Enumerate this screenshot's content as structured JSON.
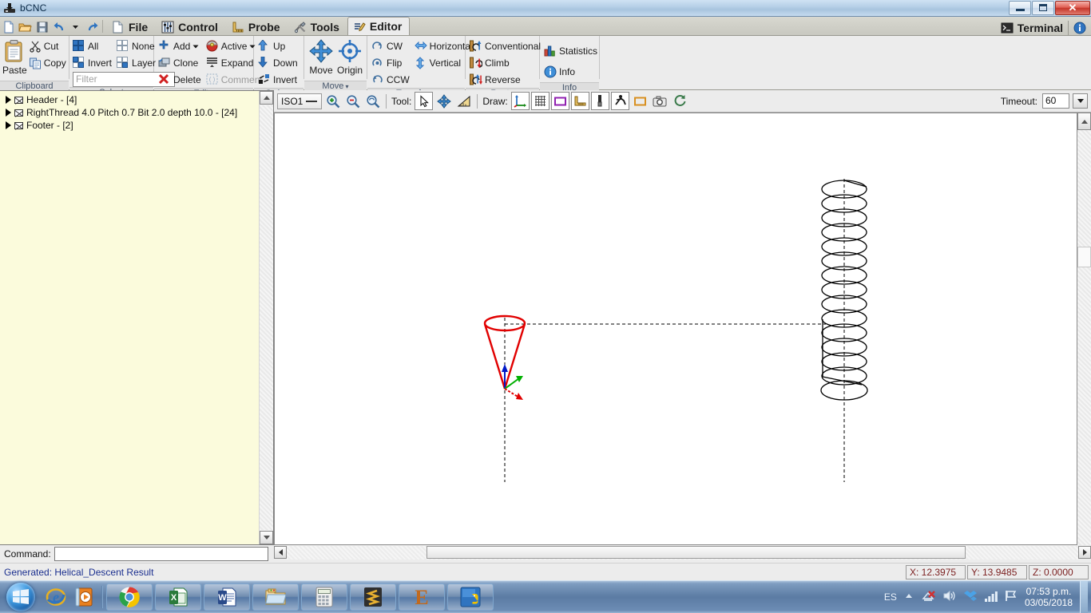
{
  "window": {
    "title": "bCNC",
    "icon": "bcnc-app-icon",
    "minimize_label": "Minimize",
    "maximize_label": "Maximize",
    "close_label": "Close"
  },
  "quick_access": [
    {
      "name": "new-file-icon",
      "label": "New"
    },
    {
      "name": "open-folder-icon",
      "label": "Open"
    },
    {
      "name": "save-icon",
      "label": "Save"
    },
    {
      "name": "undo-icon",
      "label": "Undo"
    },
    {
      "name": "undo-dropdown-icon",
      "label": "Undo history"
    },
    {
      "name": "redo-icon",
      "label": "Redo"
    }
  ],
  "tabs": [
    {
      "label": "File",
      "icon": "page-icon",
      "active": false
    },
    {
      "label": "Control",
      "icon": "sliders-icon",
      "active": false
    },
    {
      "label": "Probe",
      "icon": "ruler-icon",
      "active": false
    },
    {
      "label": "Tools",
      "icon": "tools-icon",
      "active": false
    },
    {
      "label": "Editor",
      "icon": "editor-pen-icon",
      "active": true
    }
  ],
  "tab_right": {
    "terminal_label": "Terminal",
    "terminal_icon": "terminal-icon",
    "info_icon": "info-icon"
  },
  "ribbon": {
    "groups": [
      {
        "name": "clipboard",
        "label": "Clipboard",
        "has_arrow": false,
        "big_buttons": [
          {
            "label": "Paste",
            "icon": "paste-icon"
          }
        ],
        "items": [
          {
            "label": "Cut",
            "icon": "cut-scissors-icon",
            "disabled": false
          },
          {
            "label": "Copy",
            "icon": "copy-icon",
            "disabled": false
          }
        ]
      },
      {
        "name": "select",
        "label": "Select",
        "has_arrow": false,
        "items": [
          {
            "label": "All",
            "icon": "select-all-icon",
            "disabled": false
          },
          {
            "label": "None",
            "icon": "select-none-icon",
            "disabled": false
          },
          {
            "label": "Invert",
            "icon": "select-invert-icon",
            "disabled": false
          },
          {
            "label": "Layer",
            "icon": "select-layer-icon",
            "disabled": false
          }
        ],
        "filter": {
          "placeholder": "Filter",
          "value": ""
        }
      },
      {
        "name": "edit",
        "label": "Edit",
        "has_arrow": true,
        "items": [
          {
            "label": "Add",
            "icon": "add-plus-icon",
            "dropdown": true,
            "disabled": false
          },
          {
            "label": "Active",
            "icon": "active-ball-icon",
            "dropdown": true,
            "disabled": false
          },
          {
            "label": "Clone",
            "icon": "clone-icon",
            "disabled": false
          },
          {
            "label": "Expand",
            "icon": "expand-icon",
            "disabled": false
          },
          {
            "label": "Delete",
            "icon": "delete-x-icon",
            "disabled": false
          },
          {
            "label": "Comment",
            "icon": "comment-icon",
            "disabled": true
          }
        ]
      },
      {
        "name": "order",
        "label": "Order",
        "has_arrow": true,
        "items": [
          {
            "label": "Up",
            "icon": "arrow-up-icon",
            "disabled": false
          },
          {
            "label": "Down",
            "icon": "arrow-down-icon",
            "disabled": false
          },
          {
            "label": "Invert",
            "icon": "order-invert-icon",
            "disabled": false
          }
        ]
      },
      {
        "name": "move",
        "label": "Move",
        "has_arrow": true,
        "big_buttons": [
          {
            "label": "Move",
            "icon": "move-cross-arrows-icon"
          },
          {
            "label": "Origin",
            "icon": "origin-target-icon"
          }
        ],
        "items": []
      },
      {
        "name": "transform",
        "label": "Transform",
        "has_arrow": false,
        "items": [
          {
            "label": "CW",
            "icon": "rotate-cw-icon",
            "disabled": false
          },
          {
            "label": "Horizontal",
            "icon": "flip-horizontal-icon",
            "disabled": false
          },
          {
            "label": "Flip",
            "icon": "flip-icon",
            "disabled": false
          },
          {
            "label": "Vertical",
            "icon": "flip-vertical-icon",
            "disabled": false
          },
          {
            "label": "CCW",
            "icon": "rotate-ccw-icon",
            "disabled": false
          }
        ]
      },
      {
        "name": "route",
        "label": "Route",
        "has_arrow": false,
        "items": [
          {
            "label": "Conventional",
            "icon": "conventional-icon",
            "disabled": false
          },
          {
            "label": "Climb",
            "icon": "climb-icon",
            "disabled": false
          },
          {
            "label": "Reverse",
            "icon": "reverse-icon",
            "disabled": false
          }
        ]
      },
      {
        "name": "info",
        "label": "Info",
        "has_arrow": false,
        "items": [
          {
            "label": "Statistics",
            "icon": "statistics-bars-icon",
            "disabled": false
          },
          {
            "label": "Info",
            "icon": "info-circle-icon",
            "disabled": false
          }
        ]
      }
    ]
  },
  "tree": {
    "rows": [
      {
        "label": "Header - [4]",
        "expander": "collapsed",
        "icon": "block-envelope-icon"
      },
      {
        "label": "RightThread 4.0 Pitch 0.7 Bit 2.0 depth 10.0 - [24]",
        "expander": "collapsed",
        "icon": "block-envelope-icon"
      },
      {
        "label": "Footer - [2]",
        "expander": "collapsed",
        "icon": "block-envelope-icon"
      }
    ]
  },
  "canvas_toolbar": {
    "view_selector": {
      "value": "ISO1",
      "name": "view-mode-selector"
    },
    "zoom_buttons": [
      {
        "name": "zoom-in-icon",
        "label": "Zoom In"
      },
      {
        "name": "zoom-out-icon",
        "label": "Zoom Out"
      },
      {
        "name": "zoom-fit-icon",
        "label": "Zoom Fit"
      }
    ],
    "tool_label": "Tool:",
    "tool_buttons": [
      {
        "name": "select-pointer-icon",
        "label": "Select",
        "active": true
      },
      {
        "name": "pan-move-icon",
        "label": "Pan",
        "active": false
      },
      {
        "name": "gantry-ruler-icon",
        "label": "Ruler",
        "active": false
      }
    ],
    "draw_label": "Draw:",
    "draw_buttons": [
      {
        "name": "axes-icon",
        "label": "Axes",
        "active": true
      },
      {
        "name": "grid-icon",
        "label": "Grid",
        "active": true
      },
      {
        "name": "margin-rect-icon",
        "label": "Margin",
        "active": true
      },
      {
        "name": "probe-ruler-icon",
        "label": "Probe",
        "active": true
      },
      {
        "name": "endmill-icon",
        "label": "Endmill",
        "active": true
      },
      {
        "name": "path-runner-icon",
        "label": "Paths",
        "active": true
      },
      {
        "name": "workarea-icon",
        "label": "Work area",
        "active": false
      },
      {
        "name": "camera-icon",
        "label": "Camera",
        "active": false
      },
      {
        "name": "reset-icon",
        "label": "Reset",
        "active": false
      }
    ],
    "timeout_label": "Timeout:",
    "timeout_value": "60"
  },
  "drawing": {
    "name": "gcode-preview-canvas",
    "description": "Helical descent toolpath preview",
    "accent_tool_color": "#e10000",
    "path_color": "#000000"
  },
  "command_bar": {
    "label": "Command:",
    "value": "",
    "placeholder": ""
  },
  "status": {
    "message": "Generated: Helical_Descent Result",
    "coords": [
      {
        "name": "coord-x",
        "label": "X: 12.3975"
      },
      {
        "name": "coord-y",
        "label": "Y: 13.9485"
      },
      {
        "name": "coord-z",
        "label": "Z: 0.0000"
      }
    ]
  },
  "taskbar": {
    "start_label": "Start",
    "quick_launch": [
      {
        "name": "internet-explorer-icon",
        "label": "Internet Explorer"
      },
      {
        "name": "media-player-icon",
        "label": "Windows Media Player"
      }
    ],
    "task_buttons": [
      {
        "name": "chrome-icon",
        "label": "Google Chrome"
      },
      {
        "name": "excel-icon",
        "label": "Microsoft Excel"
      },
      {
        "name": "word-icon",
        "label": "Microsoft Word"
      },
      {
        "name": "explorer-icon",
        "label": "Windows Explorer"
      },
      {
        "name": "calculator-icon",
        "label": "Calculator"
      },
      {
        "name": "sublime-icon",
        "label": "Sublime Text"
      },
      {
        "name": "editor-e-icon",
        "label": "Editor"
      },
      {
        "name": "python-icon",
        "label": "Python"
      }
    ],
    "tray": {
      "language": "ES",
      "icons": [
        {
          "name": "show-hidden-icons-icon",
          "label": "Show hidden icons"
        },
        {
          "name": "network-disconnected-icon",
          "label": "Network"
        },
        {
          "name": "volume-icon",
          "label": "Volume"
        },
        {
          "name": "dropbox-icon",
          "label": "Dropbox"
        },
        {
          "name": "signal-bars-icon",
          "label": "Signal"
        },
        {
          "name": "action-flag-icon",
          "label": "Action Center"
        }
      ],
      "time": "07:53 p.m.",
      "date": "03/05/2018"
    }
  }
}
